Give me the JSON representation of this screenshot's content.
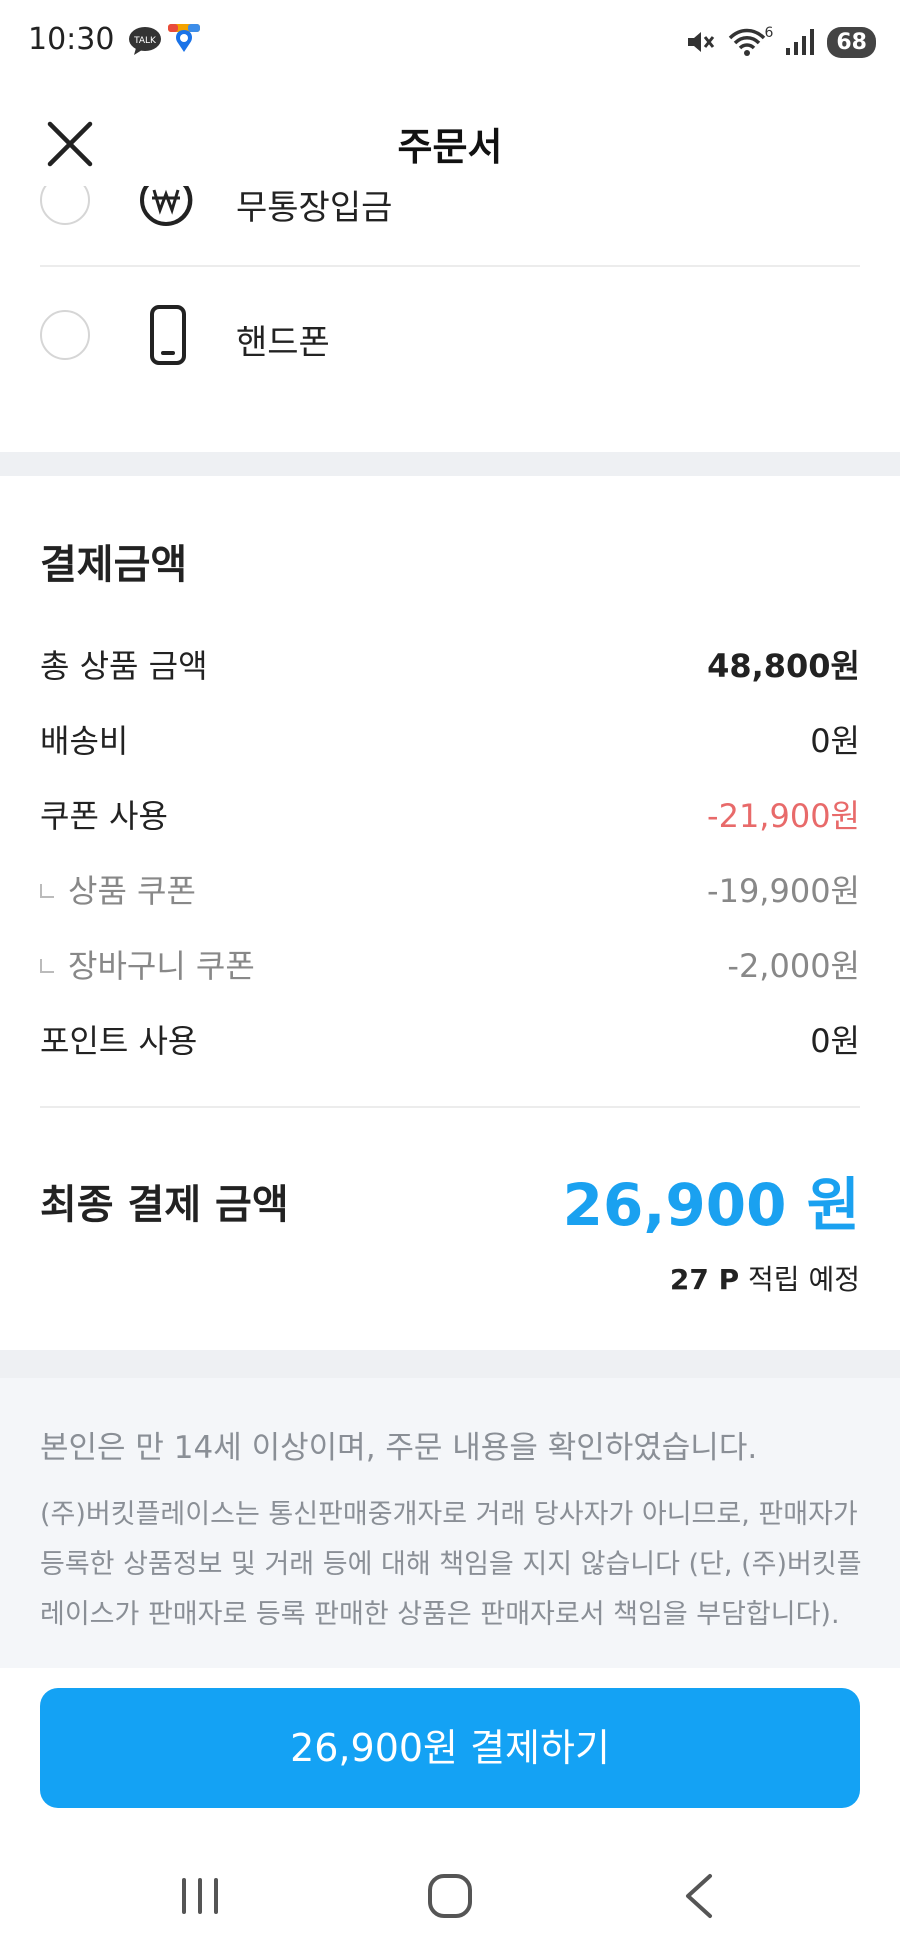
{
  "status_bar": {
    "time": "10:30",
    "talk_label": "TALK",
    "battery": "68",
    "wifi_badge": "6"
  },
  "header": {
    "title": "주문서"
  },
  "payment_methods": [
    {
      "label": "무통장입금",
      "icon": "won-coin-icon"
    },
    {
      "label": "핸드폰",
      "icon": "phone-icon"
    }
  ],
  "summary": {
    "title": "결제금액",
    "rows": [
      {
        "label": "총 상품 금액",
        "value": "48,800원"
      },
      {
        "label": "배송비",
        "value": "0원"
      },
      {
        "label": "쿠폰 사용",
        "value": "-21,900원"
      },
      {
        "label": "상품 쿠폰",
        "value": "-19,900원"
      },
      {
        "label": "장바구니 쿠폰",
        "value": "-2,000원"
      },
      {
        "label": "포인트 사용",
        "value": "0원"
      }
    ],
    "final_label": "최종 결제 금액",
    "final_value": "26,900 원",
    "points_amount": "27 P",
    "points_text": "적립 예정"
  },
  "notice": {
    "age_confirm": "본인은 만 14세 이상이며, 주문 내용을 확인하였습니다.",
    "disclaimer": "(주)버킷플레이스는 통신판매중개자로 거래 당사자가 아니므로, 판매자가 등록한 상품정보 및 거래 등에 대해 책임을 지지 않습니다 (단, (주)버킷플레이스가 판매자로 등록 판매한 상품은 판매자로서 책임을 부담합니다)."
  },
  "pay_button": {
    "label": "26,900원 결제하기"
  },
  "colors": {
    "accent": "#14a2f4",
    "final_amount": "#1aa1f0",
    "coupon_red": "#e86a6a",
    "muted_text": "#8a8f96",
    "section_gap": "#eef0f3"
  }
}
